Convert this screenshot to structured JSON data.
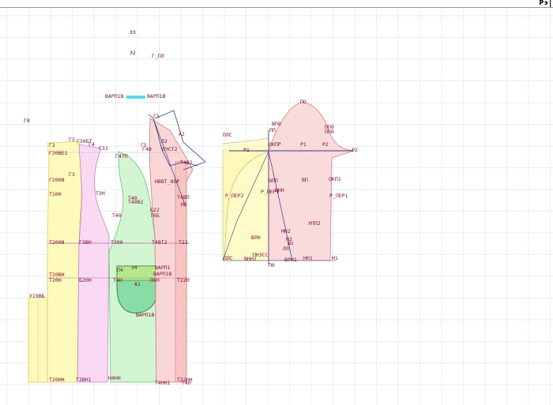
{
  "toolbar": {
    "zoom_label": "Рэ"
  },
  "colors": {
    "grid": "#dfe8ee",
    "back_fill": "#fdf9b0",
    "side_fill": "#f9d6f2",
    "mid_fill": "#cdf5cc",
    "pocket_fill": "#8fe0a8",
    "front_fill": "#f9d0d0",
    "sleeve_fill": "#f9d7d7",
    "line": "#3a3a8a",
    "label": "#7a1030"
  },
  "labels": {
    "t1": "Э3",
    "t2": "Э2",
    "t3": "Г_ПЛ",
    "t4": "ВАРП1В",
    "t5": "ВАРП1В",
    "t6": "Г0",
    "t7": "Г2",
    "t8": "Г3",
    "t9": "Г30БТ",
    "t10": "Г20ВЕ1",
    "t11": "Г3",
    "t12": "Г200В",
    "t13": "Т100",
    "t14": "Т200В",
    "t15": "Т20ВН",
    "t16": "Т20Н",
    "t17": "Б20Н",
    "t18": "У19ВБ",
    "t19": "Т20НН",
    "t20": "Г3ВН",
    "t21": "Т3ВН1",
    "t22": "Г4",
    "t23": "Г31",
    "t24": "Т3Н",
    "t25": "Т300",
    "t26": "Т40",
    "t27": "Г4ТП",
    "t28": "Г5",
    "t29": "Т40",
    "t30": "Т40В2",
    "t31": "П4",
    "t32": "А1",
    "t33": "П6Н",
    "t34": "ВАРП1В",
    "t35": "Т4Н",
    "t36": "Н4НН",
    "t37": "Э4",
    "t38": "ВАРП1",
    "t39": "Г1",
    "t40": "Г4В",
    "t41": "ЕЧСТ2",
    "t42": "А2",
    "t43": "Л2",
    "t44": "НВВТ_8ОР",
    "t45": "Т4В2",
    "t46": "Т4ВП",
    "t47": "Б22",
    "t48": "Т6Б",
    "t49": "Т4ВТ2",
    "t50": "Т22",
    "t51": "Т22Н",
    "t52": "Т22НН",
    "t53": "Т4НН1",
    "t54": "Т40",
    "t55": "Н6",
    "t56": "ВАРП1В",
    "t57": "ПО",
    "t58": "Р2",
    "t59": "ВП0",
    "t60": "ПП0",
    "t61": "ПП",
    "t62": "ПП0",
    "t63": "ПЛС",
    "t64": "Р1",
    "t65": "ОКПР",
    "t66": "Р1",
    "t67": "Р2",
    "t68": "ОПП",
    "t69": "Р_ПЕР2",
    "t70": "ВНН",
    "t71": "ВП",
    "t72": "Р_ПЕР1",
    "t73": "ОКП1",
    "t74": "Р_ПЕР1",
    "t75": "УПП2",
    "t76": "МН2",
    "t77": "Н1",
    "t78": "НН1",
    "t79": "ЛЛ",
    "t80": "ВРН1",
    "t81": "ПЛС",
    "t82": "ВНН2",
    "t83": "ВЛ0",
    "t84": "Н2",
    "t85": "Ш1",
    "t86": "ПНЗСС",
    "t87": "П0"
  }
}
